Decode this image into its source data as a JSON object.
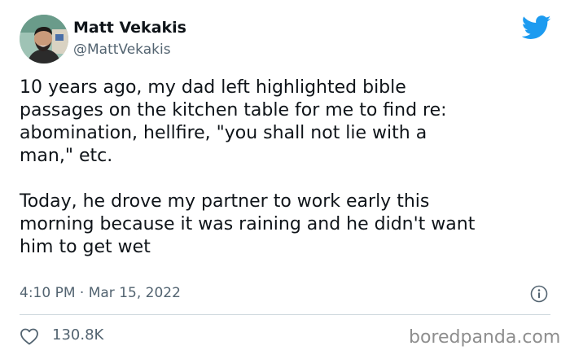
{
  "tweet": {
    "author_name": "Matt Vekakis",
    "handle": "@MattVekakis",
    "text": "10 years ago, my dad left highlighted bible\npassages on the kitchen table for me to find re:\nabomination, hellfire, \"you shall not lie with a\nman,\" etc.\n\nToday, he drove my partner to work early this\nmorning because it was raining and he didn't want\nhim to get wet",
    "timestamp": "4:10 PM · Mar 15, 2022",
    "like_count": "130.8K"
  },
  "icons": {
    "brand": "twitter-bird-icon",
    "info": "info-icon",
    "like": "heart-icon"
  },
  "watermark": "boredpanda.com",
  "colors": {
    "twitter_blue": "#1d9bf0",
    "text_primary": "#0f1419",
    "text_secondary": "#536471",
    "divider": "#cfd9de",
    "watermark": "#8e8e8e"
  }
}
